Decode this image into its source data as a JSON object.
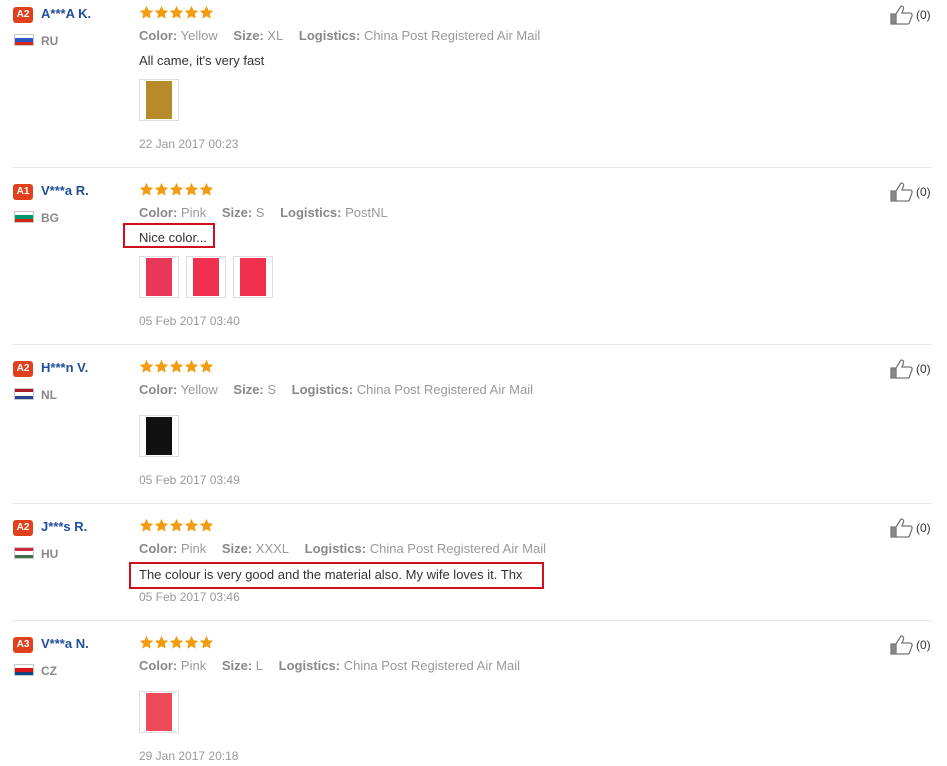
{
  "labels": {
    "color": "Color:",
    "size": "Size:",
    "logistics": "Logistics:"
  },
  "colors": {
    "badge": "#e0401d",
    "username": "#1f4e9a",
    "star": "#f39c12",
    "highlight": "#d0101a"
  },
  "reviews": [
    {
      "level": "A2",
      "user": "A***A K.",
      "country": "RU",
      "flag": [
        "#ffffff",
        "#2b57c7",
        "#d52b1e"
      ],
      "rating": 5,
      "color": "Yellow",
      "size": "XL",
      "logistics": "China Post Registered Air Mail",
      "comment": "All came, it's very fast",
      "highlighted": false,
      "photos": [
        "#b78a2c"
      ],
      "date": "22 Jan 2017 00:23",
      "likes": "(0)"
    },
    {
      "level": "A1",
      "user": "V***a R.",
      "country": "BG",
      "flag": [
        "#ffffff",
        "#00966e",
        "#d62612"
      ],
      "rating": 5,
      "color": "Pink",
      "size": "S",
      "logistics": "PostNL",
      "comment": "Nice color...",
      "highlighted": true,
      "photos": [
        "#e8385a",
        "#f0304f",
        "#f0304f"
      ],
      "date": "05 Feb 2017 03:40",
      "likes": "(0)"
    },
    {
      "level": "A2",
      "user": "H***n V.",
      "country": "NL",
      "flag": [
        "#ae1c28",
        "#ffffff",
        "#21468b"
      ],
      "rating": 5,
      "color": "Yellow",
      "size": "S",
      "logistics": "China Post Registered Air Mail",
      "comment": "",
      "highlighted": false,
      "photos": [
        "#111111"
      ],
      "date": "05 Feb 2017 03:49",
      "likes": "(0)"
    },
    {
      "level": "A2",
      "user": "J***s R.",
      "country": "HU",
      "flag": [
        "#cd2a3e",
        "#ffffff",
        "#436f4d"
      ],
      "rating": 5,
      "color": "Pink",
      "size": "XXXL",
      "logistics": "China Post Registered Air Mail",
      "comment": "The colour is very good and the material also. My wife loves it. Thx",
      "highlighted": true,
      "photos": [],
      "date": "05 Feb 2017 03:46",
      "likes": "(0)"
    },
    {
      "level": "A3",
      "user": "V***a N.",
      "country": "CZ",
      "flag": [
        "#ffffff",
        "#d7141a",
        "#11457e"
      ],
      "rating": 5,
      "color": "Pink",
      "size": "L",
      "logistics": "China Post Registered Air Mail",
      "comment": "",
      "highlighted": false,
      "photos": [
        "#ee4a5a"
      ],
      "date": "29 Jan 2017 20:18",
      "likes": "(0)"
    }
  ]
}
